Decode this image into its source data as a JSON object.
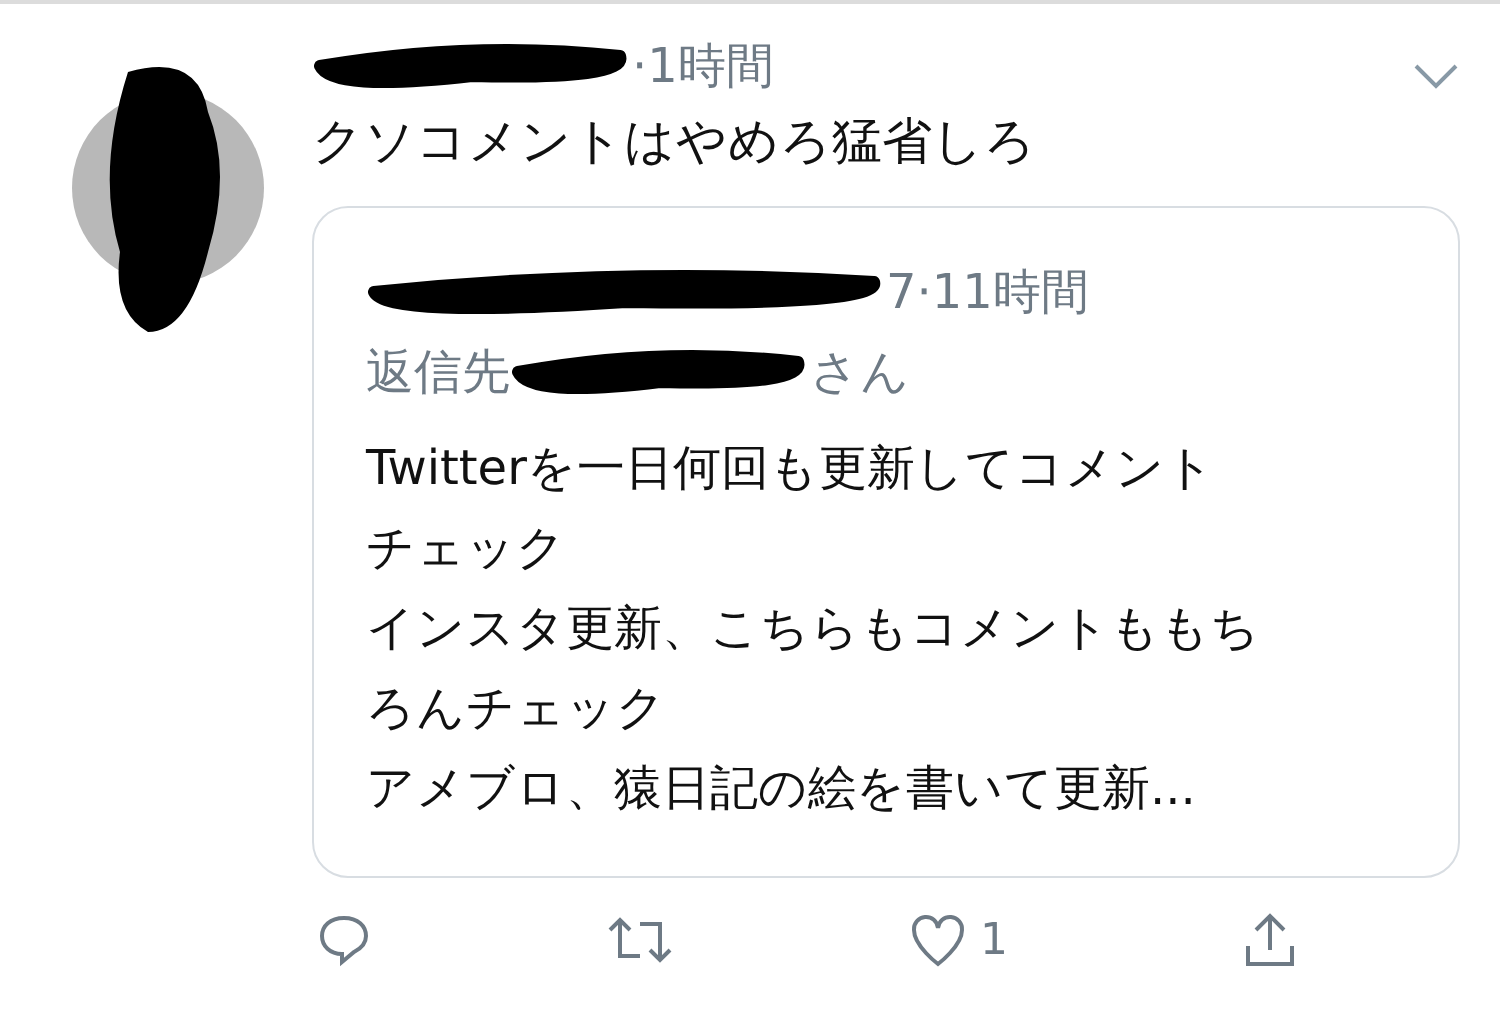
{
  "tweet": {
    "time": "·1時間",
    "text": "クソコメントはやめろ猛省しろ",
    "quoted": {
      "time": "7·11時間",
      "reply_prefix": "返信先",
      "reply_suffix": "さん",
      "lines": [
        "Twitterを一日何回も更新してコメント",
        "チェック",
        "インスタ更新、こちらもコメントももち",
        "ろんチェック",
        "アメブロ、猿日記の絵を書いて更新..."
      ]
    },
    "likes": "1"
  }
}
